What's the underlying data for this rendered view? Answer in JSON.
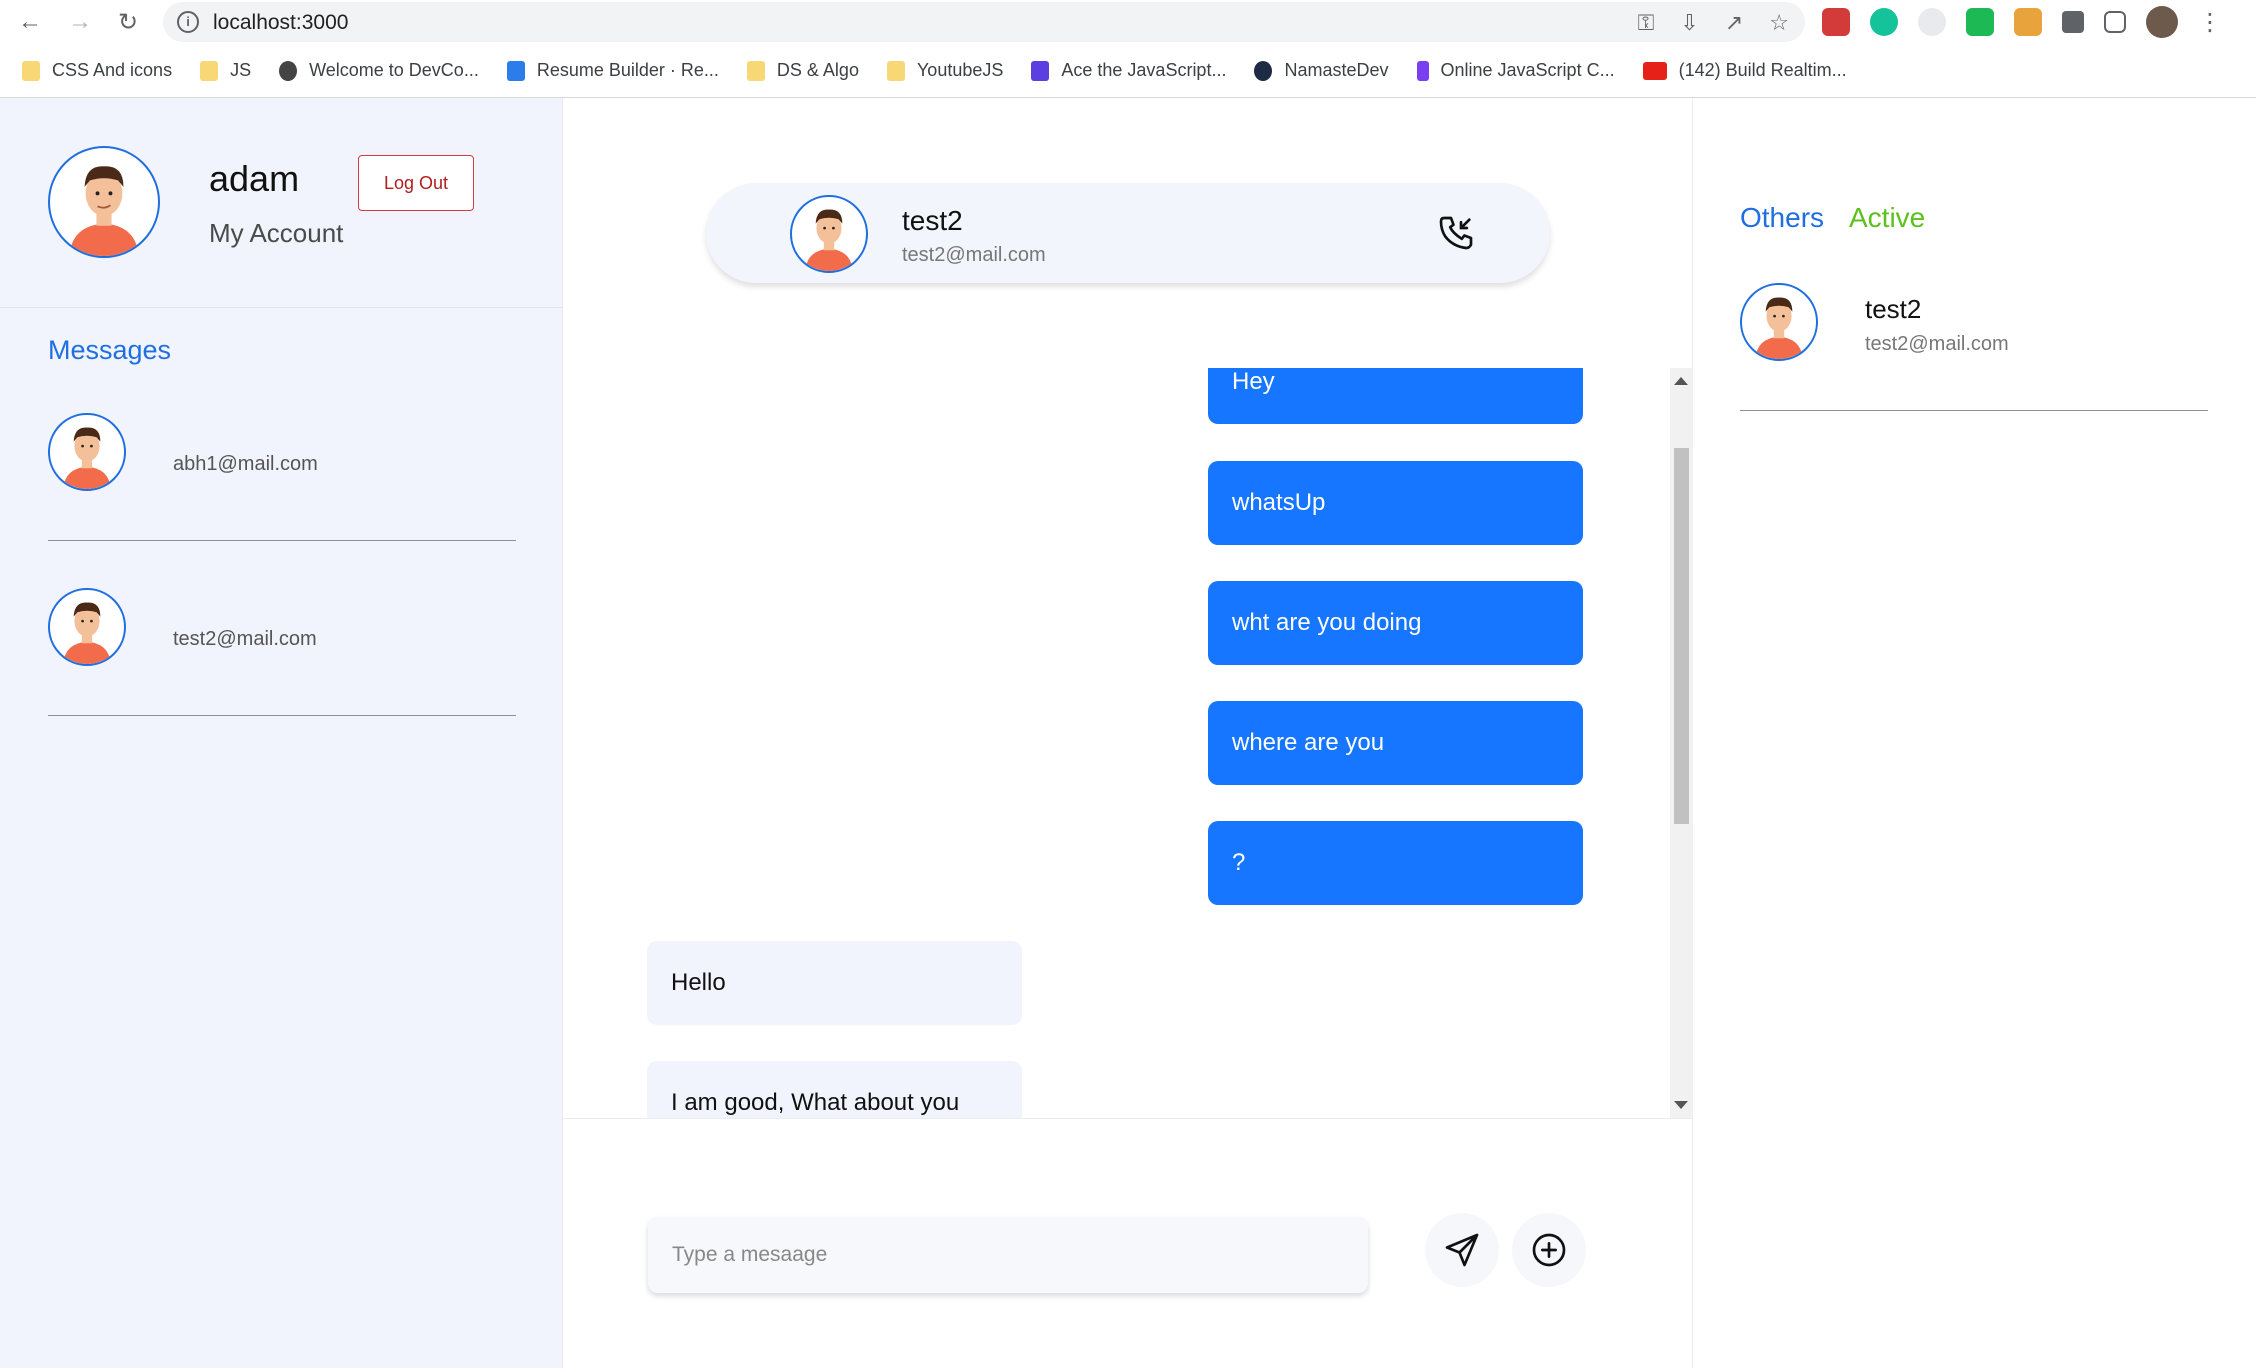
{
  "browser": {
    "url": "localhost:3000",
    "bookmarks": [
      {
        "label": "CSS And icons",
        "icon": "folder-icon"
      },
      {
        "label": "JS",
        "icon": "folder-icon"
      },
      {
        "label": "Welcome to DevCo...",
        "icon": "globe-icon"
      },
      {
        "label": "Resume Builder · Re...",
        "icon": "resume-icon"
      },
      {
        "label": "DS & Algo",
        "icon": "folder-icon"
      },
      {
        "label": "YoutubeJS",
        "icon": "folder-icon"
      },
      {
        "label": "Ace the JavaScript...",
        "icon": "terminal-icon"
      },
      {
        "label": "NamasteDev",
        "icon": "namaste-icon"
      },
      {
        "label": "Online JavaScript C...",
        "icon": "p-icon"
      },
      {
        "label": "(142) Build Realtim...",
        "icon": "youtube-icon"
      }
    ]
  },
  "account": {
    "name": "adam",
    "subtitle": "My Account",
    "logout_label": "Log Out"
  },
  "messages": {
    "title": "Messages",
    "contacts": [
      {
        "email": "abh1@mail.com"
      },
      {
        "email": "test2@mail.com"
      }
    ]
  },
  "chat": {
    "header": {
      "name": "test2",
      "email": "test2@mail.com"
    },
    "sent": [
      "Hey",
      "whatsUp",
      "wht are you doing",
      "where are you",
      "?"
    ],
    "received": [
      "Hello",
      "I am good, What about you"
    ],
    "input_placeholder": "Type a mesaage"
  },
  "sidebar_right": {
    "tabs": [
      "Others",
      "Active"
    ],
    "online_users": [
      {
        "name": "test2",
        "email": "test2@mail.com"
      }
    ]
  },
  "colors": {
    "accent": "#1f6fe0",
    "sent_bubble": "#1676ff",
    "active_tab": "#5cc11d",
    "logout": "#d63a3a"
  }
}
